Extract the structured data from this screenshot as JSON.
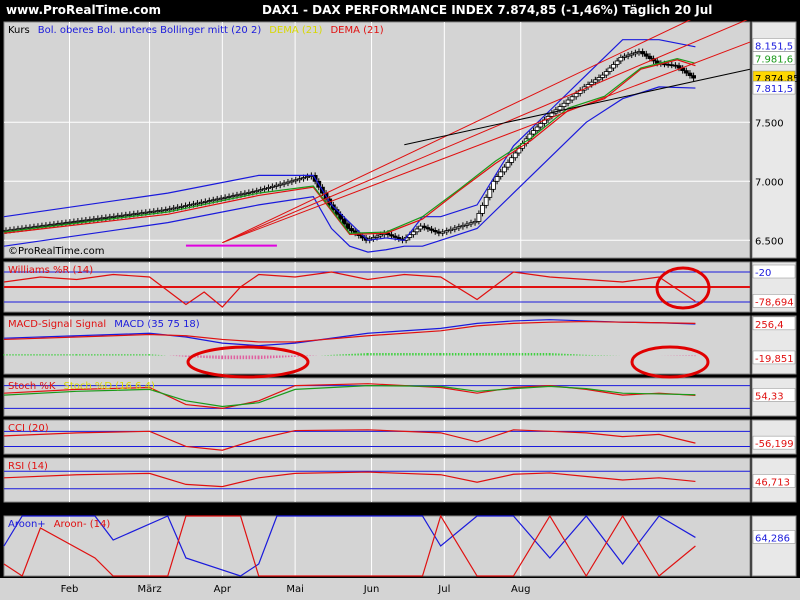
{
  "header": {
    "site": "www.ProRealTime.com",
    "title": "DAX1 - DAX PERFORMANCE INDEX   7.874,85 (-1,46%)   Täglich  20 Jul"
  },
  "colors": {
    "background": "#000000",
    "panel": "#d4d4d4",
    "grid": "#ffffff",
    "blue": "#1a1adc",
    "red": "#e01010",
    "green": "#1a9a1a",
    "yellow": "#d8d800",
    "magenta": "#e000e0",
    "black": "#000000",
    "annotation": "#e00000"
  },
  "x_axis": {
    "labels": [
      "Feb",
      "März",
      "Apr",
      "Mai",
      "Jun",
      "Jul",
      "Aug"
    ]
  },
  "chart_data": [
    {
      "id": "price",
      "type": "candlestick",
      "legend": [
        {
          "text": "Kurs",
          "color": "#000000"
        },
        {
          "text": "Bol. oberes Bol. unteres Bollinger mitt (20 2)",
          "color": "#1a1adc"
        },
        {
          "text": "DEMA (21)",
          "color": "#d8d800"
        },
        {
          "text": "DEMA (21)",
          "color": "#e01010"
        }
      ],
      "watermark": "©ProRealTime.com",
      "ylim": [
        6350,
        8350
      ],
      "yticks": [
        "6.500",
        "7.000",
        "7.500"
      ],
      "ytick_values": [
        6500,
        7000,
        7500
      ],
      "badges": [
        {
          "text": "8.151,5",
          "value": 8151.5,
          "bg": "#ffffff",
          "fg": "#1a1adc"
        },
        {
          "text": "7.981,6",
          "value": 8040,
          "bg": "#ffffff",
          "fg": "#1a9a1a"
        },
        {
          "text": "7.874,85",
          "value": 7874.85,
          "bg": "#ffd700",
          "fg": "#000000"
        },
        {
          "text": "7.811,5",
          "value": 7790,
          "bg": "#ffffff",
          "fg": "#1a1adc"
        }
      ],
      "series": [
        {
          "kind": "ohlc",
          "x": [
            0,
            45,
            70,
            85,
            90,
            95,
            100,
            105,
            110,
            115,
            120,
            130,
            135,
            140,
            145,
            150,
            160,
            165,
            170,
            175,
            180,
            185,
            190
          ],
          "y": [
            6580,
            6760,
            6920,
            7050,
            6800,
            6600,
            6500,
            6560,
            6500,
            6620,
            6560,
            6660,
            7000,
            7200,
            7400,
            7550,
            7800,
            7900,
            8050,
            8100,
            8000,
            7980,
            7874.85
          ]
        },
        {
          "kind": "line",
          "color": "#1a1adc",
          "x": [
            0,
            45,
            70,
            85,
            90,
            95,
            100,
            105,
            110,
            115,
            120,
            130,
            140,
            150,
            160,
            170,
            180,
            190
          ],
          "y": [
            6700,
            6900,
            7050,
            7050,
            6800,
            6650,
            6500,
            6520,
            6500,
            6700,
            6700,
            6800,
            7300,
            7600,
            7900,
            8200,
            8200,
            8140
          ]
        },
        {
          "kind": "line",
          "color": "#1a1adc",
          "x": [
            0,
            45,
            70,
            85,
            90,
            95,
            100,
            105,
            110,
            115,
            120,
            130,
            140,
            150,
            160,
            170,
            180,
            190
          ],
          "y": [
            6450,
            6650,
            6800,
            6870,
            6600,
            6450,
            6400,
            6420,
            6450,
            6450,
            6500,
            6600,
            6900,
            7200,
            7500,
            7700,
            7800,
            7790
          ]
        },
        {
          "kind": "line",
          "color": "#e01010",
          "x": [
            0,
            45,
            70,
            85,
            95,
            105,
            115,
            125,
            135,
            145,
            155,
            165,
            175,
            185,
            190
          ],
          "y": [
            6560,
            6720,
            6880,
            6950,
            6550,
            6560,
            6680,
            6920,
            7150,
            7350,
            7600,
            7700,
            7950,
            8030,
            7980
          ]
        },
        {
          "kind": "line",
          "color": "#1a9a1a",
          "x": [
            0,
            45,
            70,
            85,
            95,
            105,
            115,
            125,
            135,
            145,
            155,
            165,
            175,
            185,
            190
          ],
          "y": [
            6570,
            6740,
            6900,
            6960,
            6560,
            6570,
            6700,
            6930,
            7170,
            7370,
            7620,
            7720,
            7960,
            8040,
            8000
          ]
        },
        {
          "kind": "trendline",
          "color": "#e01010",
          "x": [
            60,
            205
          ],
          "y": [
            6480,
            8610
          ]
        },
        {
          "kind": "trendline",
          "color": "#e01010",
          "x": [
            60,
            205
          ],
          "y": [
            6480,
            8380
          ]
        },
        {
          "kind": "trendline",
          "color": "#e01010",
          "x": [
            60,
            205
          ],
          "y": [
            6480,
            8180
          ]
        },
        {
          "kind": "trendline",
          "color": "#000000",
          "x": [
            110,
            205
          ],
          "y": [
            7310,
            7950
          ]
        },
        {
          "kind": "trendline",
          "color": "#e000e0",
          "x": [
            50,
            75
          ],
          "y": [
            6455,
            6455
          ]
        }
      ]
    },
    {
      "id": "williams",
      "type": "line",
      "legend": [
        {
          "text": "Williams %R (14)",
          "color": "#e01010"
        }
      ],
      "ylim": [
        -100,
        0
      ],
      "hlines": [
        {
          "value": -20,
          "color": "#1a1adc"
        },
        {
          "value": -80,
          "color": "#1a1adc"
        },
        {
          "value": -50,
          "color": "#e01010"
        }
      ],
      "badges": [
        {
          "text": "-20",
          "value": -20,
          "bg": "#ffffff",
          "fg": "#1a1adc"
        },
        {
          "text": "-78,694",
          "value": -78.694,
          "bg": "#ffffff",
          "fg": "#e01010"
        }
      ],
      "series": [
        {
          "name": "Williams %R",
          "color": "#e01010",
          "x": [
            0,
            10,
            20,
            30,
            40,
            50,
            55,
            60,
            65,
            70,
            80,
            90,
            100,
            110,
            120,
            130,
            140,
            150,
            160,
            170,
            180,
            190
          ],
          "y": [
            -40,
            -30,
            -35,
            -25,
            -30,
            -85,
            -60,
            -90,
            -50,
            -25,
            -30,
            -20,
            -35,
            -25,
            -30,
            -75,
            -20,
            -30,
            -35,
            -40,
            -30,
            -78.694
          ]
        }
      ]
    },
    {
      "id": "macd",
      "type": "line",
      "legend": [
        {
          "text": "MACD-Signal Signal",
          "color": "#e01010"
        },
        {
          "text": "MACD (35 75 18)",
          "color": "#1a1adc"
        }
      ],
      "ylim": [
        -150,
        320
      ],
      "badges": [
        {
          "text": "256,4",
          "value": 256.4,
          "bg": "#ffffff",
          "fg": "#e01010"
        },
        {
          "text": "-19,851",
          "value": -19.851,
          "bg": "#ffffff",
          "fg": "#e01010"
        }
      ],
      "series": [
        {
          "name": "MACD",
          "color": "#1a1adc",
          "x": [
            0,
            20,
            40,
            50,
            60,
            70,
            80,
            100,
            120,
            130,
            140,
            150,
            160,
            170,
            180,
            190
          ],
          "y": [
            140,
            160,
            180,
            150,
            100,
            80,
            100,
            180,
            220,
            260,
            280,
            290,
            280,
            270,
            265,
            255
          ]
        },
        {
          "name": "Signal",
          "color": "#e01010",
          "x": [
            0,
            20,
            40,
            50,
            60,
            70,
            80,
            100,
            120,
            130,
            140,
            150,
            160,
            170,
            180,
            190
          ],
          "y": [
            130,
            150,
            170,
            160,
            130,
            110,
            110,
            160,
            200,
            240,
            260,
            270,
            275,
            270,
            265,
            260
          ]
        },
        {
          "name": "Histogram",
          "kind": "hist",
          "x": [
            0,
            20,
            40,
            50,
            60,
            70,
            80,
            100,
            120,
            130,
            140,
            150,
            160,
            170,
            180,
            190
          ],
          "y": [
            10,
            10,
            10,
            -10,
            -30,
            -30,
            -10,
            20,
            20,
            20,
            20,
            20,
            5,
            0,
            0,
            -5
          ]
        }
      ]
    },
    {
      "id": "stoch",
      "type": "line",
      "legend": [
        {
          "text": "Stoch %K",
          "color": "#e01010"
        },
        {
          "text": "Stoch %D (16 6 4)",
          "color": "#d8d800"
        }
      ],
      "ylim": [
        0,
        100
      ],
      "hlines": [
        {
          "value": 80,
          "color": "#1a1adc"
        },
        {
          "value": 20,
          "color": "#1a1adc"
        }
      ],
      "badges": [
        {
          "text": "54,33",
          "value": 54.33,
          "bg": "#ffffff",
          "fg": "#e01010"
        }
      ],
      "series": [
        {
          "name": "%K",
          "color": "#e01010",
          "x": [
            0,
            20,
            40,
            50,
            60,
            70,
            80,
            100,
            120,
            130,
            140,
            150,
            160,
            170,
            180,
            190
          ],
          "y": [
            60,
            70,
            75,
            30,
            20,
            40,
            80,
            85,
            75,
            60,
            75,
            80,
            70,
            55,
            60,
            54.33
          ]
        },
        {
          "name": "%D",
          "color": "#1a9a1a",
          "x": [
            0,
            20,
            40,
            50,
            60,
            70,
            80,
            100,
            120,
            130,
            140,
            150,
            160,
            170,
            180,
            190
          ],
          "y": [
            55,
            65,
            70,
            40,
            25,
            35,
            70,
            80,
            78,
            65,
            72,
            78,
            72,
            60,
            58,
            56
          ]
        }
      ]
    },
    {
      "id": "cci",
      "type": "line",
      "legend": [
        {
          "text": "CCI (20)",
          "color": "#e01010"
        }
      ],
      "ylim": [
        -200,
        250
      ],
      "hlines": [
        {
          "value": 100,
          "color": "#1a1adc"
        },
        {
          "value": -100,
          "color": "#1a1adc"
        }
      ],
      "badges": [
        {
          "text": "-56,199",
          "value": -56.199,
          "bg": "#ffffff",
          "fg": "#e01010"
        }
      ],
      "series": [
        {
          "name": "CCI",
          "color": "#e01010",
          "x": [
            0,
            20,
            40,
            50,
            60,
            70,
            80,
            100,
            120,
            130,
            140,
            150,
            160,
            170,
            180,
            190
          ],
          "y": [
            40,
            80,
            100,
            -100,
            -150,
            0,
            110,
            120,
            80,
            -40,
            120,
            100,
            80,
            30,
            60,
            -56.199
          ]
        }
      ]
    },
    {
      "id": "rsi",
      "type": "line",
      "legend": [
        {
          "text": "RSI (14)",
          "color": "#e01010"
        }
      ],
      "ylim": [
        0,
        100
      ],
      "hlines": [
        {
          "value": 70,
          "color": "#1a1adc"
        },
        {
          "value": 30,
          "color": "#1a1adc"
        }
      ],
      "badges": [
        {
          "text": "46,713",
          "value": 46.713,
          "bg": "#ffffff",
          "fg": "#e01010"
        }
      ],
      "series": [
        {
          "name": "RSI",
          "color": "#e01010",
          "x": [
            0,
            20,
            40,
            50,
            60,
            70,
            80,
            100,
            120,
            130,
            140,
            150,
            160,
            170,
            180,
            190
          ],
          "y": [
            55,
            62,
            65,
            40,
            35,
            55,
            65,
            68,
            62,
            45,
            63,
            66,
            58,
            50,
            55,
            46.713
          ]
        }
      ]
    },
    {
      "id": "aroon",
      "type": "line",
      "legend": [
        {
          "text": "Aroon+",
          "color": "#1a1adc"
        },
        {
          "text": "Aroon- (14)",
          "color": "#e01010"
        }
      ],
      "ylim": [
        0,
        100
      ],
      "badges": [
        {
          "text": "64,286",
          "value": 64.286,
          "bg": "#ffffff",
          "fg": "#1a1adc"
        }
      ],
      "series": [
        {
          "name": "Aroon+",
          "color": "#1a1adc",
          "x": [
            0,
            5,
            10,
            25,
            30,
            45,
            50,
            65,
            70,
            75,
            85,
            100,
            115,
            120,
            130,
            140,
            150,
            160,
            170,
            180,
            190
          ],
          "y": [
            50,
            100,
            100,
            100,
            60,
            100,
            30,
            0,
            20,
            100,
            100,
            100,
            100,
            50,
            100,
            100,
            30,
            100,
            20,
            100,
            64.286
          ]
        },
        {
          "name": "Aroon-",
          "color": "#e01010",
          "x": [
            0,
            5,
            10,
            25,
            30,
            45,
            50,
            65,
            70,
            75,
            85,
            100,
            115,
            120,
            130,
            140,
            150,
            160,
            170,
            180,
            190
          ],
          "y": [
            20,
            0,
            80,
            30,
            0,
            0,
            100,
            100,
            0,
            0,
            0,
            0,
            0,
            100,
            0,
            0,
            100,
            0,
            100,
            0,
            50
          ]
        }
      ]
    }
  ]
}
